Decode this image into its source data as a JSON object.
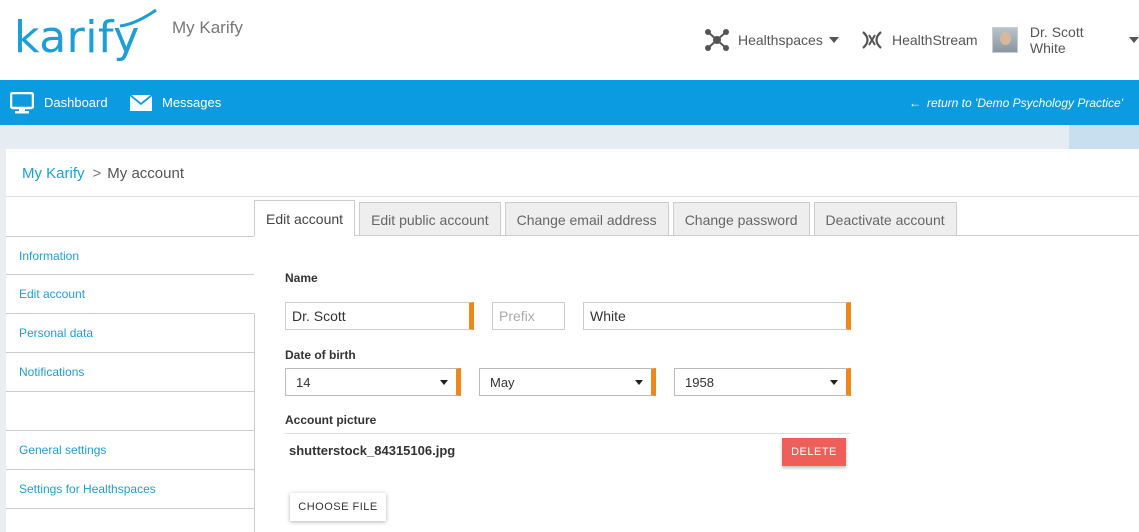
{
  "header": {
    "logo_text": "karify",
    "app_title": "My Karify",
    "healthspaces_label": "Healthspaces",
    "healthstream_label": "HealthStream",
    "user_name": "Dr. Scott White"
  },
  "navbar": {
    "dashboard_label": "Dashboard",
    "messages_label": "Messages",
    "return_label": "return to 'Demo Psychology Practice'"
  },
  "breadcrumb": {
    "parent": "My Karify",
    "separator": ">",
    "current": "My account"
  },
  "sidebar": {
    "items": [
      {
        "label": "Information"
      },
      {
        "label": "Edit account"
      },
      {
        "label": "Personal data"
      },
      {
        "label": "Notifications"
      },
      {
        "label": ""
      },
      {
        "label": "General settings"
      },
      {
        "label": "Settings for Healthspaces"
      }
    ]
  },
  "tabs": [
    {
      "label": "Edit account"
    },
    {
      "label": "Edit public account"
    },
    {
      "label": "Change email address"
    },
    {
      "label": "Change password"
    },
    {
      "label": "Deactivate account"
    }
  ],
  "form": {
    "name_label": "Name",
    "first_name_value": "Dr. Scott",
    "prefix_placeholder": "Prefix",
    "last_name_value": "White",
    "dob_label": "Date of birth",
    "day_value": "14",
    "month_value": "May",
    "year_value": "1958",
    "picture_label": "Account picture",
    "filename": "shutterstock_84315106.jpg",
    "delete_label": "DELETE",
    "choose_label": "CHOOSE FILE"
  },
  "colors": {
    "brand": "#1b9fd9",
    "navbar": "#0a9be0",
    "required": "#f0871a",
    "delete": "#ef5f5a"
  }
}
